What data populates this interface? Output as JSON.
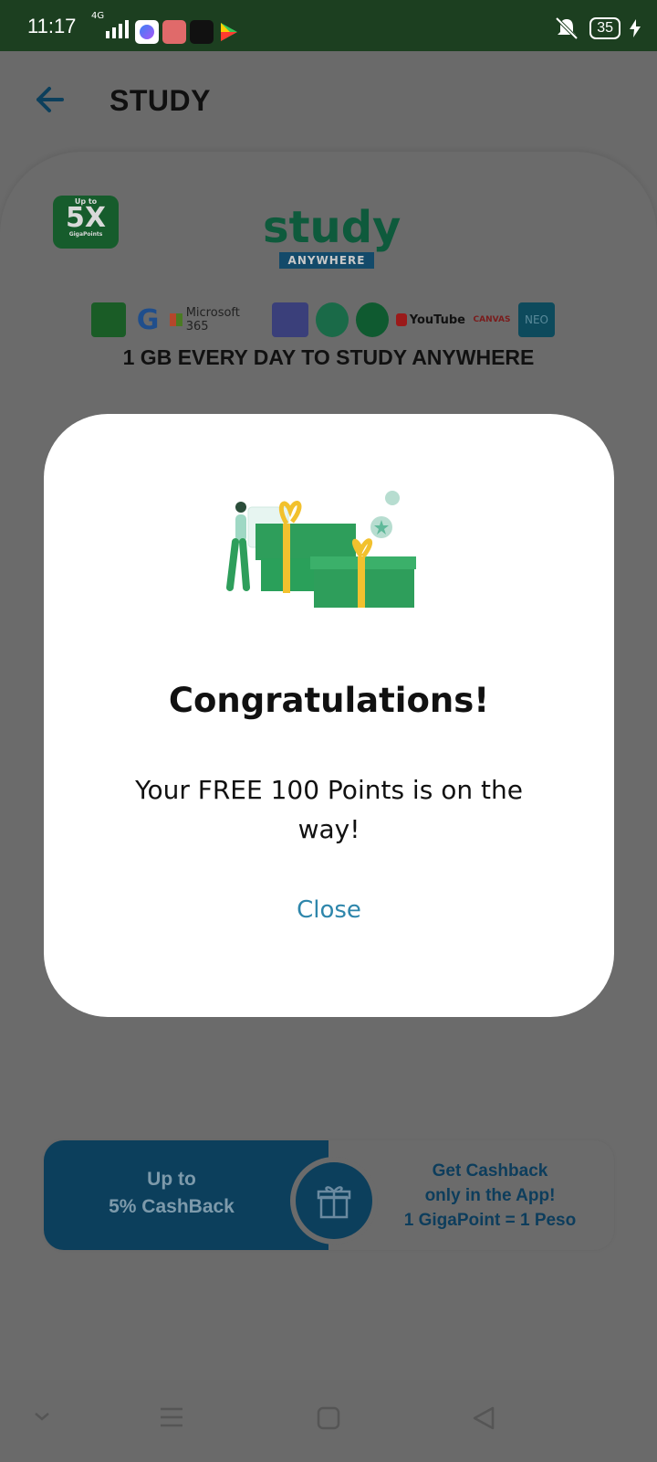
{
  "status_bar": {
    "time": "11:17",
    "network": "4G",
    "battery": "35"
  },
  "app_bar": {
    "title": "STUDY"
  },
  "promo": {
    "badge_up_to": "Up to",
    "badge_value": "5X",
    "badge_sub": "GigaPoints",
    "logo_text": "study",
    "logo_sub": "ANYWHERE",
    "apps": [
      "Google Classroom",
      "Google",
      "Microsoft 365",
      "Teams",
      "Gmail",
      "Meet",
      "YouTube",
      "CANVAS",
      "NEO"
    ],
    "app_labels": {
      "microsoft": "Microsoft 365",
      "youtube": "YouTube",
      "canvas": "CANVAS",
      "neo": "NEO"
    },
    "tagline": "1 GB EVERY DAY TO STUDY ANYWHERE"
  },
  "cashback": {
    "left_line1": "Up to",
    "left_line2": "5% CashBack",
    "right_line1": "Get Cashback",
    "right_line2": "only in the App!",
    "right_line3": "1 GigaPoint = 1 Peso"
  },
  "modal": {
    "title": "Congratulations!",
    "message": "Your FREE 100 Points is on the way!",
    "close_label": "Close"
  },
  "colors": {
    "accent_green": "#2e9e5b",
    "link_blue": "#2e86ab",
    "status_bar": "#1c3f20",
    "dark_blue": "#0c3f5c"
  }
}
